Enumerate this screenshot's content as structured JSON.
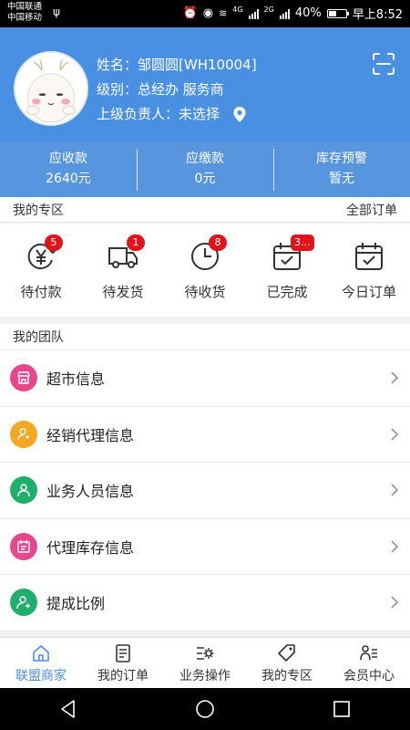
{
  "status_bar": {
    "carrier1": "中国联通",
    "carrier2": "中国移动",
    "net1": "4G",
    "net2": "2G",
    "battery": "40%",
    "time": "早上8:52"
  },
  "profile": {
    "name_label": "姓名：",
    "name_value": "邹圆圆[WH10004]",
    "level_label": "级别：",
    "level_value": "总经办 服务商",
    "superior_label": "上级负责人：",
    "superior_value": "未选择"
  },
  "stats": [
    {
      "label": "应收款",
      "value": "2640元"
    },
    {
      "label": "应缴款",
      "value": "0元"
    },
    {
      "label": "库存预警",
      "value": "暂无"
    }
  ],
  "zone": {
    "title": "我的专区",
    "all_orders": "全部订单",
    "items": [
      {
        "label": "待付款",
        "badge": "5",
        "icon": "yen-refresh-icon"
      },
      {
        "label": "待发货",
        "badge": "1",
        "icon": "truck-icon"
      },
      {
        "label": "待收货",
        "badge": "8",
        "icon": "clock-icon"
      },
      {
        "label": "已完成",
        "badge": "3...",
        "icon": "calendar-check-icon"
      },
      {
        "label": "今日订单",
        "badge": "",
        "icon": "calendar-check-icon"
      }
    ]
  },
  "team": {
    "title": "我的团队",
    "items": [
      {
        "label": "超市信息",
        "color": "#e8478d",
        "icon": "store-icon"
      },
      {
        "label": "经销代理信息",
        "color": "#f5a623",
        "icon": "agent-icon"
      },
      {
        "label": "业务人员信息",
        "color": "#1fae6c",
        "icon": "person-icon"
      },
      {
        "label": "代理库存信息",
        "color": "#e8478d",
        "icon": "inventory-icon"
      },
      {
        "label": "提成比例",
        "color": "#1fae6c",
        "icon": "person-plus-icon"
      }
    ]
  },
  "tabs": [
    {
      "label": "联盟商家",
      "active": true
    },
    {
      "label": "我的订单",
      "active": false
    },
    {
      "label": "业务操作",
      "active": false
    },
    {
      "label": "我的专区",
      "active": false
    },
    {
      "label": "会员中心",
      "active": false
    }
  ],
  "colors": {
    "accent": "#4a90e2",
    "badge": "#e0141a"
  }
}
